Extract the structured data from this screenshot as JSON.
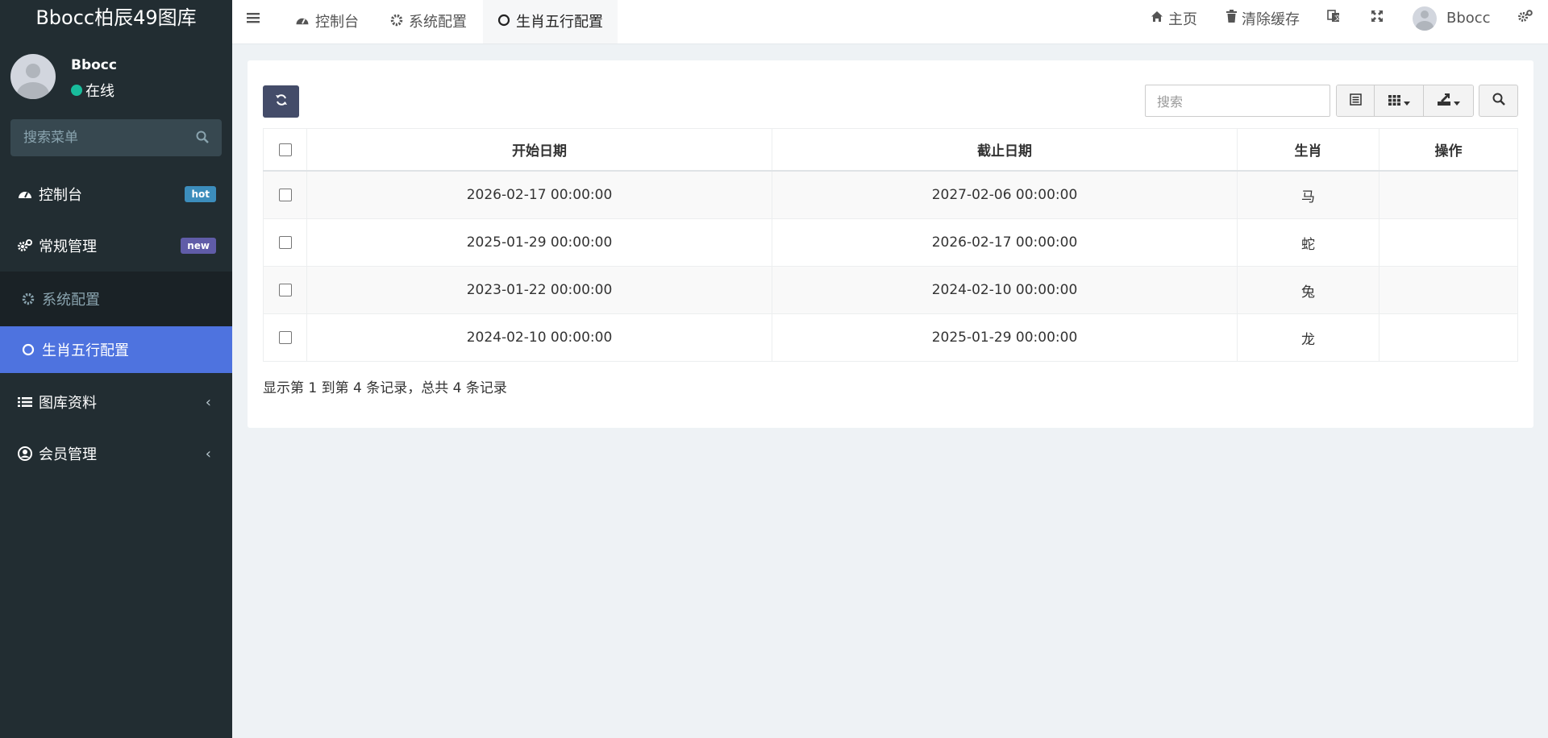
{
  "app": {
    "title": "Bbocc柏辰49图库"
  },
  "user": {
    "name": "Bbocc",
    "status": "在线",
    "status_color": "#18bc9c"
  },
  "sidebar": {
    "search_placeholder": "搜索菜单",
    "items": [
      {
        "label": "控制台",
        "icon": "dashboard-icon",
        "badge": "hot",
        "badge_color": "#3c8dbc"
      },
      {
        "label": "常规管理",
        "icon": "cogs-icon",
        "badge": "new",
        "badge_color": "#605ca8"
      },
      {
        "label": "系统配置",
        "icon": "gear-icon"
      },
      {
        "label": "生肖五行配置",
        "icon": "circle-o-icon",
        "active": true
      },
      {
        "label": "图库资料",
        "icon": "list-icon"
      },
      {
        "label": "会员管理",
        "icon": "user-circle-icon"
      }
    ]
  },
  "topbar": {
    "tabs": [
      {
        "label": "控制台",
        "icon": "dashboard-icon"
      },
      {
        "label": "系统配置",
        "icon": "gear-icon"
      },
      {
        "label": "生肖五行配置",
        "icon": "circle-o-icon",
        "active": true
      }
    ],
    "home_label": "主页",
    "clear_cache_label": "清除缓存",
    "user_name": "Bbocc"
  },
  "toolbar": {
    "search_placeholder": "搜索"
  },
  "table": {
    "columns": [
      "开始日期",
      "截止日期",
      "生肖",
      "操作"
    ],
    "rows": [
      {
        "start": "2026-02-17 00:00:00",
        "end": "2027-02-06 00:00:00",
        "zodiac": "马",
        "action": ""
      },
      {
        "start": "2025-01-29 00:00:00",
        "end": "2026-02-17 00:00:00",
        "zodiac": "蛇",
        "action": ""
      },
      {
        "start": "2023-01-22 00:00:00",
        "end": "2024-02-10 00:00:00",
        "zodiac": "兔",
        "action": ""
      },
      {
        "start": "2024-02-10 00:00:00",
        "end": "2025-01-29 00:00:00",
        "zodiac": "龙",
        "action": ""
      }
    ]
  },
  "pagination": {
    "info": "显示第 1 到第 4 条记录，总共 4 条记录"
  },
  "colors": {
    "accent": "#4e73df",
    "sidebar_bg": "#222d32",
    "refresh_btn": "#444c69"
  }
}
